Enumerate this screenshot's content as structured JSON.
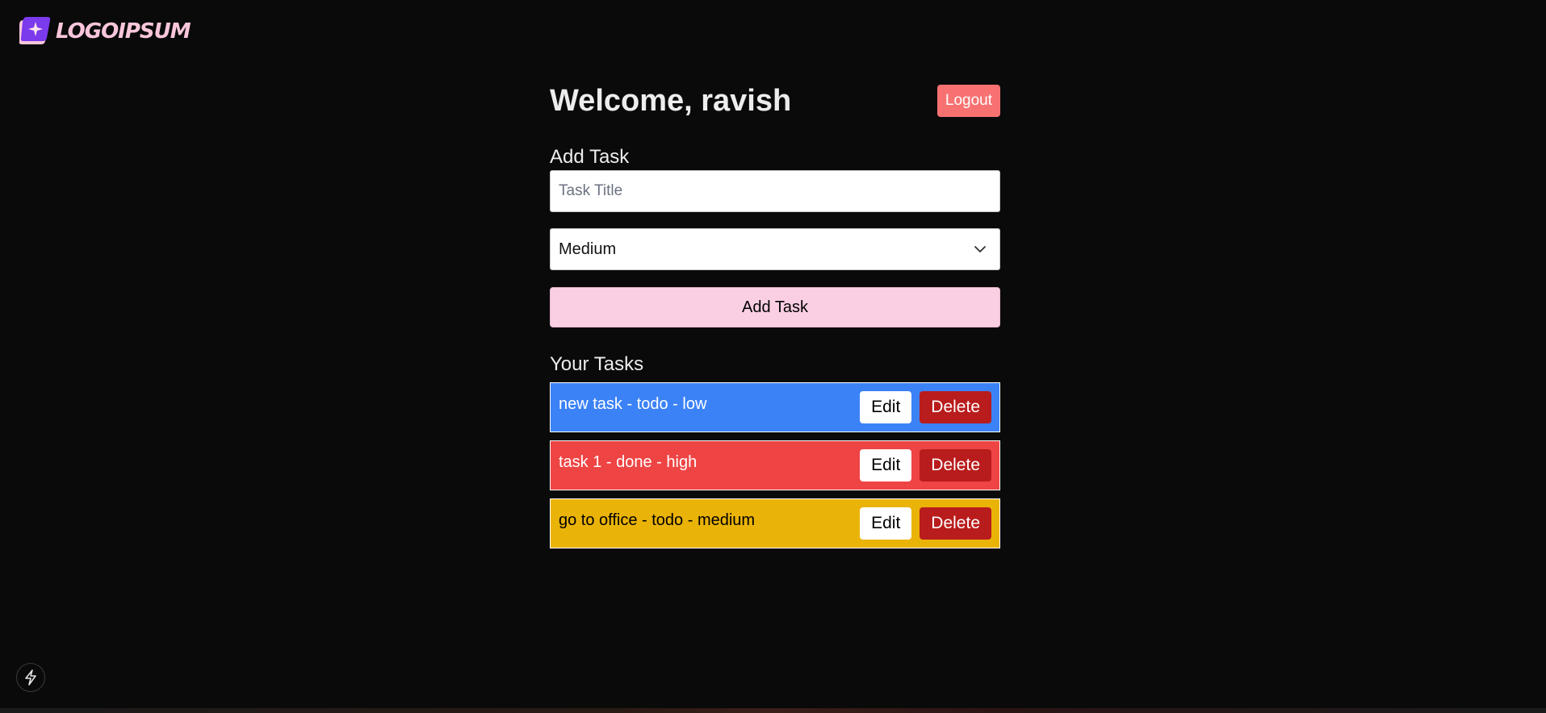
{
  "brand": {
    "logo_text": "LOGOIPSUM",
    "accent": "#f9c6dc",
    "mark_color": "#7c3aed"
  },
  "header": {
    "welcome": "Welcome, ravish",
    "logout_label": "Logout"
  },
  "add_task": {
    "heading": "Add Task",
    "title_placeholder": "Task Title",
    "title_value": "",
    "priority_selected": "Medium",
    "submit_label": "Add Task"
  },
  "tasks_section": {
    "heading": "Your Tasks",
    "edit_label": "Edit",
    "delete_label": "Delete",
    "items": [
      {
        "label": "new task - todo - low",
        "bg": "#3b82f6",
        "text_color": "#ffffff"
      },
      {
        "label": "task 1 - done - high",
        "bg": "#ef4444",
        "text_color": "#ffffff"
      },
      {
        "label": "go to office - todo - medium",
        "bg": "#eab308",
        "text_color": "#000000"
      }
    ]
  },
  "colors": {
    "background": "#0a0a0a",
    "logout": "#f87171",
    "add_button": "#fbcfe3",
    "delete_button": "#b91c1c"
  },
  "icons": {
    "dev_indicator": "lightning-bolt-icon",
    "select_chevron": "chevron-down-icon"
  }
}
